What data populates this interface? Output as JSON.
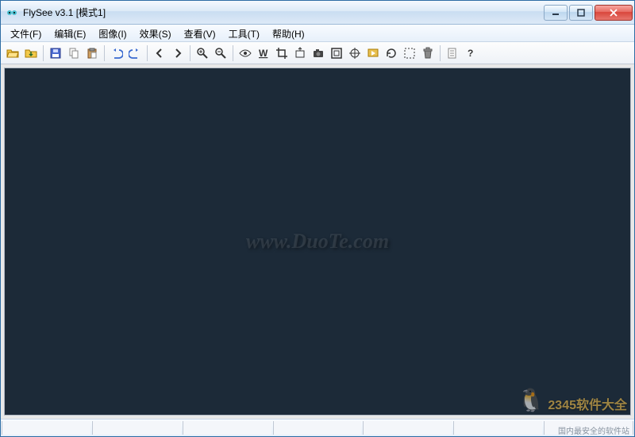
{
  "title": "FlySee v3.1 [模式1]",
  "menus": {
    "file": "文件(F)",
    "edit": "编辑(E)",
    "image": "图像(I)",
    "effect": "效果(S)",
    "view": "查看(V)",
    "tools": "工具(T)",
    "help": "帮助(H)"
  },
  "toolbar_names": {
    "open": "open-icon",
    "collect": "folder-in-icon",
    "save": "save-icon",
    "copy": "copy-icon",
    "paste": "paste-icon",
    "undo": "undo-icon",
    "redo": "redo-icon",
    "prev": "arrow-left-icon",
    "next": "arrow-right-icon",
    "zoomin": "zoom-in-icon",
    "zoomout": "zoom-out-icon",
    "eye": "eye-icon",
    "wallpaper": "wallpaper-icon",
    "crop": "crop-icon",
    "capture": "capture-icon",
    "camera": "camera-icon",
    "fullscreen": "fullscreen-icon",
    "target": "target-icon",
    "slideshow": "slideshow-icon",
    "rotate": "rotate-icon",
    "select": "select-icon",
    "trash": "trash-icon",
    "info": "info-icon",
    "whatsthis": "whats-this-icon"
  },
  "watermark": {
    "center": "www.DuoTe.com",
    "corner_brand": "2345软件大全",
    "corner_sub": "国内最安全的软件站"
  },
  "status_panels": 7,
  "colors": {
    "canvas_bg": "#1c2a38",
    "titlebar_from": "#f4f9ff",
    "titlebar_to": "#dde9f7",
    "close_red": "#d9463b"
  }
}
